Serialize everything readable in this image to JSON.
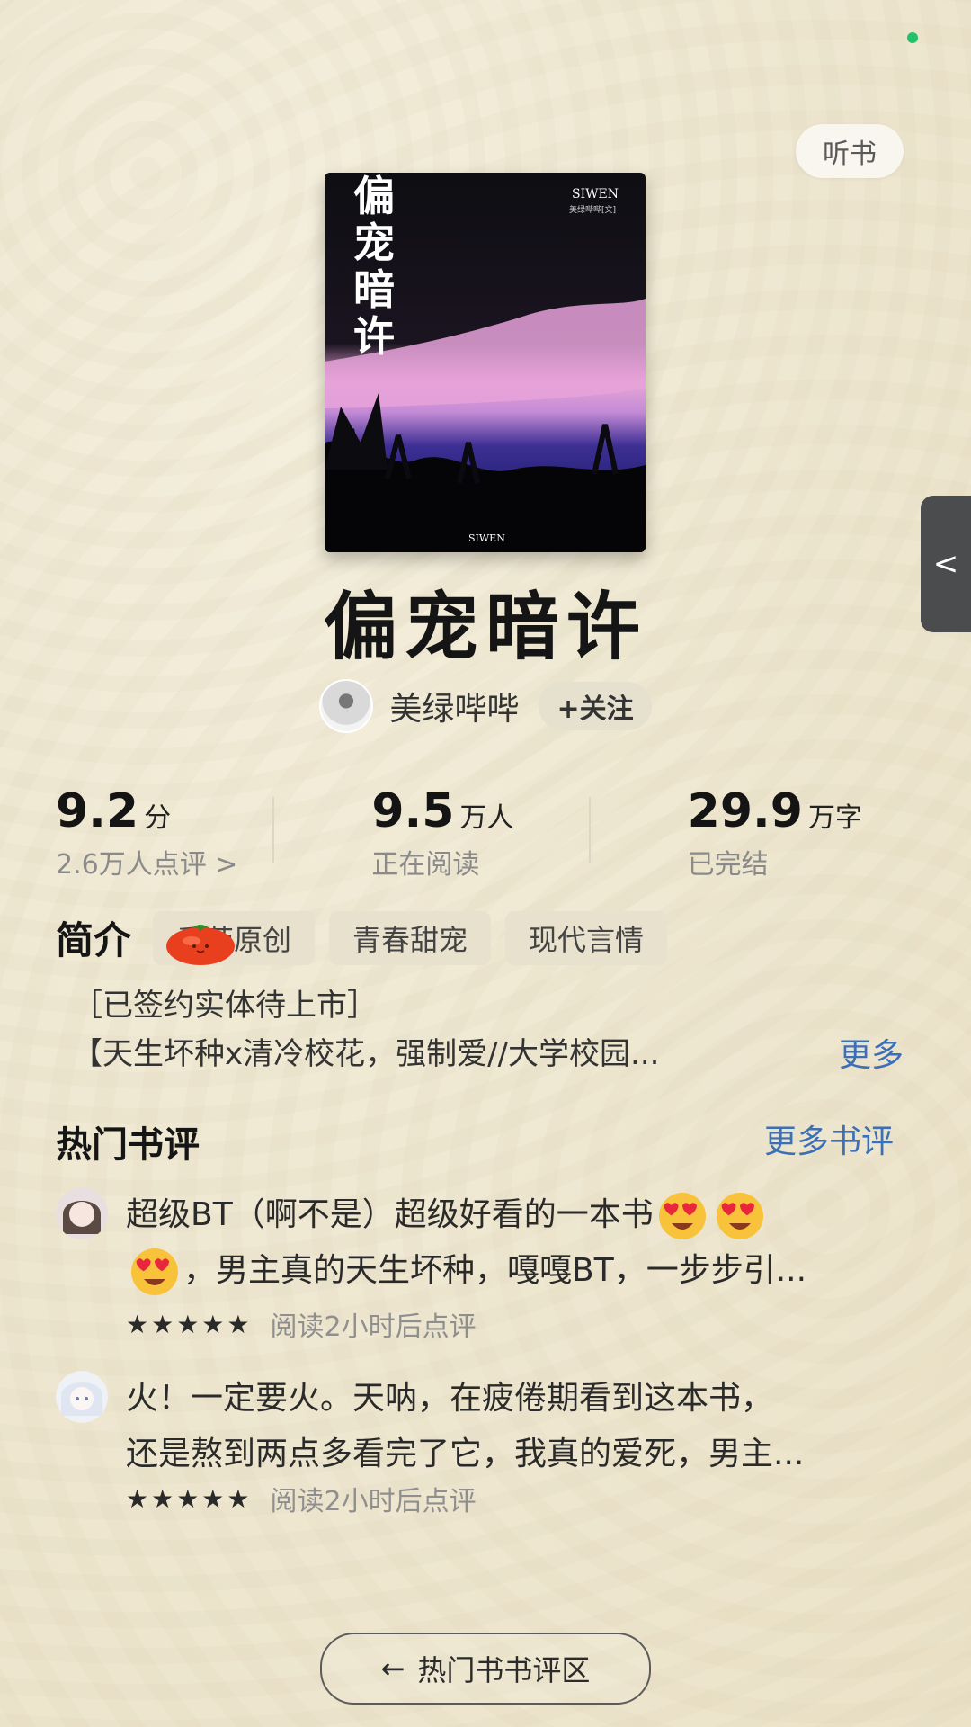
{
  "header": {
    "listen_label": "听书"
  },
  "book": {
    "title": "偏宠暗许",
    "cover": {
      "title_vertical": "偏宠暗许",
      "brand_top": "SIWEN",
      "publisher": "美绿哔哔[文]",
      "brand_bottom": "SIWEN"
    }
  },
  "author": {
    "name": "美绿哔哔",
    "follow_label": "+关注"
  },
  "stats": [
    {
      "big": "9.2",
      "unit": "分",
      "sub": "2.6万人点评 >"
    },
    {
      "big": "9.5",
      "unit": "万人",
      "sub": "正在阅读"
    },
    {
      "big": "29.9",
      "unit": "万字",
      "sub": "已完结"
    }
  ],
  "intro": {
    "label": "简介",
    "tags": [
      "番茄原创",
      "青春甜宠",
      "现代言情"
    ],
    "line1": "［已签约实体待上市］",
    "line2": "【天生坏种x清冷校花，强制爱//大学校园...",
    "more_label": "更多"
  },
  "reviews_section": {
    "title": "热门书评",
    "more_label": "更多书评",
    "items": [
      {
        "line1": "超级BT（啊不是）超级好看的一本书",
        "line2": "，男主真的天生坏种，嘎嘎BT，一步步引...",
        "stars": "★★★★★",
        "meta": "阅读2小时后点评"
      },
      {
        "line1": "火！一定要火。天呐，在疲倦期看到这本书，",
        "line2": "还是熬到两点多看完了它，我真的爱死，男主...",
        "stars": "★★★★★",
        "meta": "阅读2小时后点评"
      }
    ]
  },
  "bottom": {
    "arrow": "←",
    "label": "热门书书评区"
  },
  "side_tab": {
    "icon": "<"
  },
  "icons": {
    "status": "status-dot-icon",
    "tomato": "tomato-icon",
    "emoji": "heart-eyes-emoji-icon"
  },
  "colors": {
    "accent_link": "#3b6fb6",
    "status_dot": "#22c26b",
    "side_tab": "#4a4c4e"
  }
}
